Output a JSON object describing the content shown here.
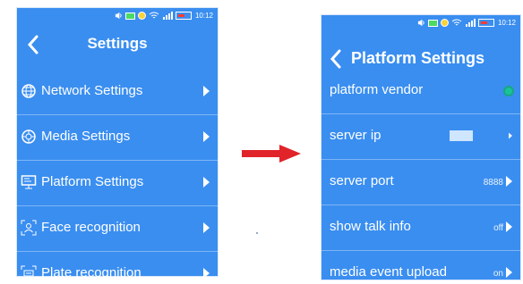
{
  "left_screen": {
    "status": {
      "time": "10:12"
    },
    "title": "Settings",
    "items": [
      {
        "label": "Network Settings",
        "icon": "globe-icon"
      },
      {
        "label": "Media Settings",
        "icon": "media-icon"
      },
      {
        "label": "Platform Settings",
        "icon": "monitor-icon"
      },
      {
        "label": "Face recognition",
        "icon": "face-scan-icon"
      },
      {
        "label": "Plate recognition",
        "icon": "plate-scan-icon"
      }
    ]
  },
  "right_screen": {
    "status": {
      "time": "10:12"
    },
    "title": "Platform Settings",
    "items": [
      {
        "label": "platform vendor",
        "value": "",
        "control": "toggle"
      },
      {
        "label": "server ip",
        "value": "",
        "control": "text-box"
      },
      {
        "label": "server port",
        "value": "8888"
      },
      {
        "label": "show talk info",
        "value": "off"
      },
      {
        "label": "media event upload",
        "value": "on"
      }
    ]
  },
  "colors": {
    "screen_bg": "#3a8ef0",
    "arrow": "#e0242a",
    "toggle": "#19c39a"
  },
  "arrow_icon": "right-arrow-icon"
}
